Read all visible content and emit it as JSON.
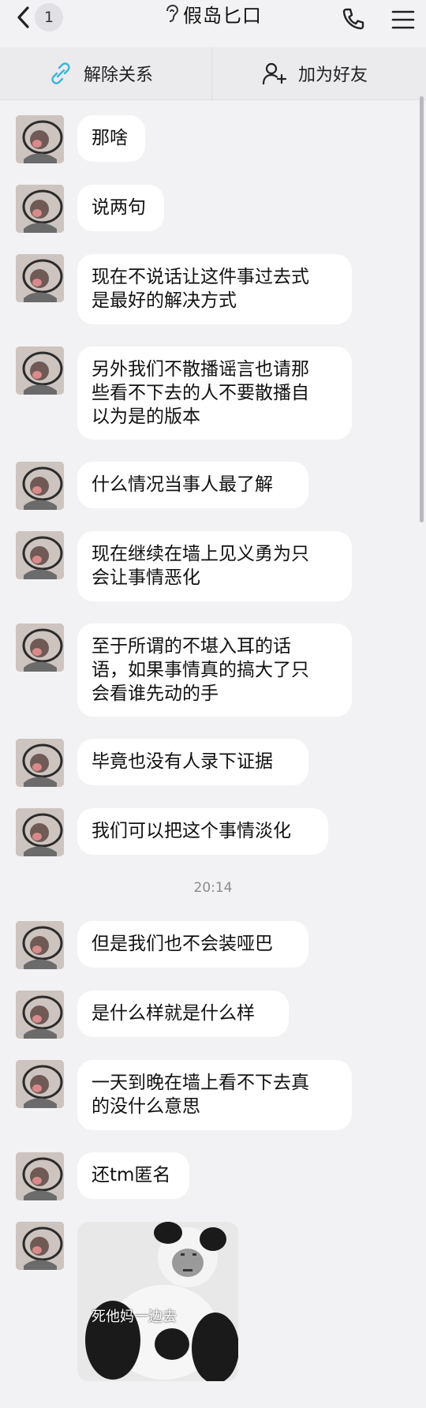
{
  "header": {
    "back_count": "1",
    "title": "假岛匕口",
    "icons": [
      "chevron-left-icon",
      "ear-icon",
      "phone-icon",
      "menu-icon"
    ]
  },
  "actions": {
    "unlink_label": "解除关系",
    "add_friend_label": "加为好友",
    "icons": [
      "unlink-icon",
      "add-user-icon"
    ]
  },
  "messages": [
    {
      "text": "那啥"
    },
    {
      "text": "说两句"
    },
    {
      "text": "现在不说话让这件事过去式\n是最好的解决方式"
    },
    {
      "text": "另外我们不散播谣言也请那\n些看不下去的人不要散播自\n以为是的版本"
    },
    {
      "text": "什么情况当事人最了解"
    },
    {
      "text": "现在继续在墙上见义勇为只\n会让事情恶化"
    },
    {
      "text": "至于所谓的不堪入耳的话\n语，如果事情真的搞大了只\n会看谁先动的手"
    },
    {
      "text": "毕竟也没有人录下证据"
    },
    {
      "text": "我们可以把这个事情淡化"
    },
    {
      "text": "但是我们也不会装哑巴"
    },
    {
      "text": "是什么样就是什么样"
    },
    {
      "text": "一天到晚在墙上看不下去真\n的没什么意思"
    },
    {
      "text": "还tm匿名"
    }
  ],
  "timestamp": "20:14",
  "sticker": {
    "caption": "死他妈一边去"
  },
  "colors": {
    "background": "#f2f2f4",
    "bubble": "#ffffff",
    "accent": "#3bb5d6"
  }
}
